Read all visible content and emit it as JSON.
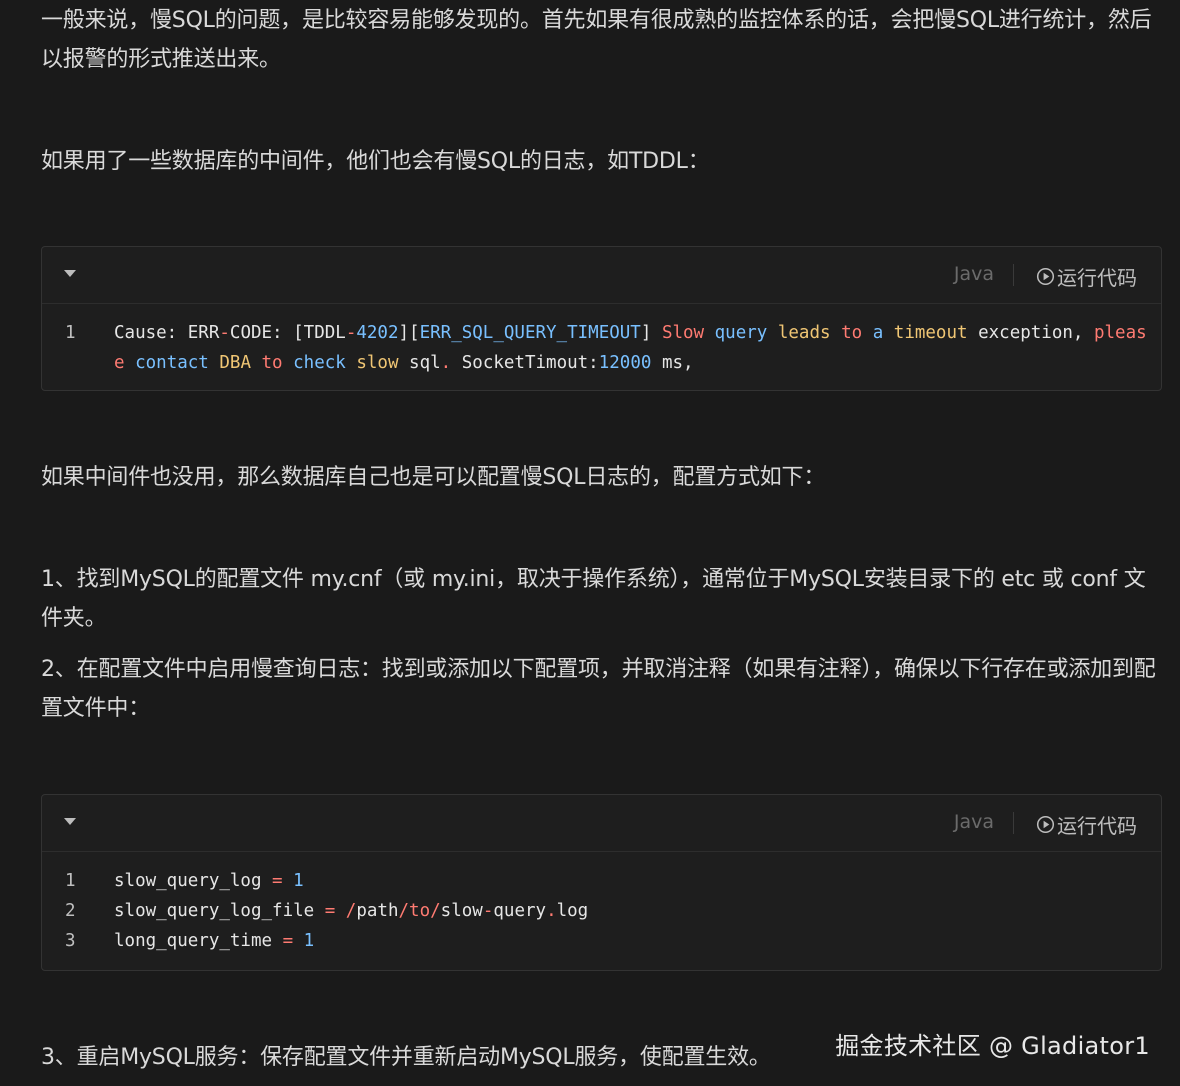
{
  "paragraphs": {
    "p1": "一般来说，慢SQL的问题，是比较容易能够发现的。首先如果有很成熟的监控体系的话，会把慢SQL进行统计，然后以报警的形式推送出来。",
    "p2": "如果用了一些数据库的中间件，他们也会有慢SQL的日志，如TDDL：",
    "p3": "如果中间件也没用，那么数据库自己也是可以配置慢SQL日志的，配置方式如下：",
    "p4": "1、找到MySQL的配置文件 my.cnf（或 my.ini，取决于操作系统），通常位于MySQL安装目录下的 etc 或 conf 文件夹。",
    "p5": "2、在配置文件中启用慢查询日志：找到或添加以下配置项，并取消注释（如果有注释），确保以下行存在或添加到配置文件中：",
    "p6": "3、重启MySQL服务：保存配置文件并重新启动MySQL服务，使配置生效。"
  },
  "code1": {
    "language": "Java",
    "run_label": "运行代码",
    "line_numbers": [
      "1"
    ],
    "tokens": {
      "t1": "Cause: ERR",
      "t2": "-",
      "t3": "CODE: [TDDL",
      "t4": "-",
      "t5": "4202",
      "t6": "][",
      "t7": "ERR_SQL_QUERY_TIMEOUT",
      "t8": "] ",
      "t9": "Slow",
      "t10": " query ",
      "t11": "leads",
      "t12": " to ",
      "t13": "a",
      "t14": " timeout",
      "t15": " exception, ",
      "t16": "please",
      "t17": " contact ",
      "t18": "DBA",
      "t19": " to ",
      "t20": "check",
      "t21": " slow",
      "t22": " sql",
      "t23": ".",
      "t24": " SocketTimout:",
      "t25": "12000",
      "t26": " ms,"
    }
  },
  "code2": {
    "language": "Java",
    "run_label": "运行代码",
    "lines": [
      {
        "num": "1",
        "a": "slow_query_log",
        "op": " = ",
        "b": "1"
      },
      {
        "num": "2",
        "a": "slow_query_log_file",
        "op": " = ",
        "p1": "/",
        "p2": "path",
        "p3": "/",
        "p4": "to",
        "p5": "/",
        "p6": "slow",
        "p7": "-",
        "p8": "query",
        "p9": ".",
        "p10": "log"
      },
      {
        "num": "3",
        "a": "long_query_time",
        "op": " = ",
        "b": "1"
      }
    ]
  },
  "watermark": "掘金技术社区 @ Gladiator1"
}
